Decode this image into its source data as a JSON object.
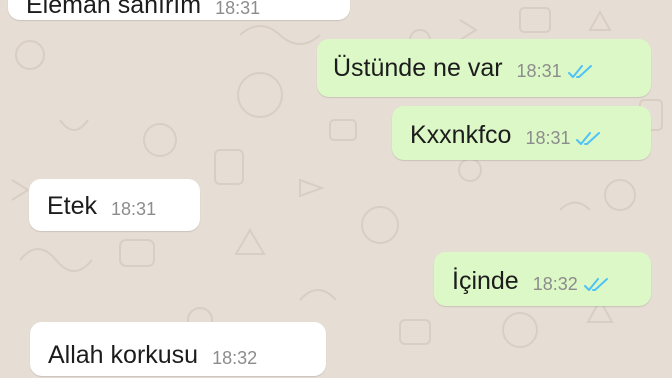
{
  "messages": [
    {
      "direction": "incoming",
      "text": "Eleman sanırım",
      "time": "18:31"
    },
    {
      "direction": "outgoing",
      "text": "Üstünde ne var",
      "time": "18:31",
      "status": "read",
      "status_icon": "double-check-icon"
    },
    {
      "direction": "outgoing",
      "text": "Kxxnkfco",
      "time": "18:31",
      "status": "read",
      "status_icon": "double-check-icon"
    },
    {
      "direction": "incoming",
      "text": "Etek",
      "time": "18:31"
    },
    {
      "direction": "outgoing",
      "text": "İçinde",
      "time": "18:32",
      "status": "read",
      "status_icon": "double-check-icon"
    },
    {
      "direction": "incoming",
      "text": "Allah korkusu",
      "time": "18:32"
    }
  ],
  "colors": {
    "wallpaper": "#e6ddd4",
    "incoming_bubble": "#ffffff",
    "outgoing_bubble": "#dcf8c6",
    "read_ticks": "#4fc3f7",
    "timestamp": "#8c8c8c"
  }
}
